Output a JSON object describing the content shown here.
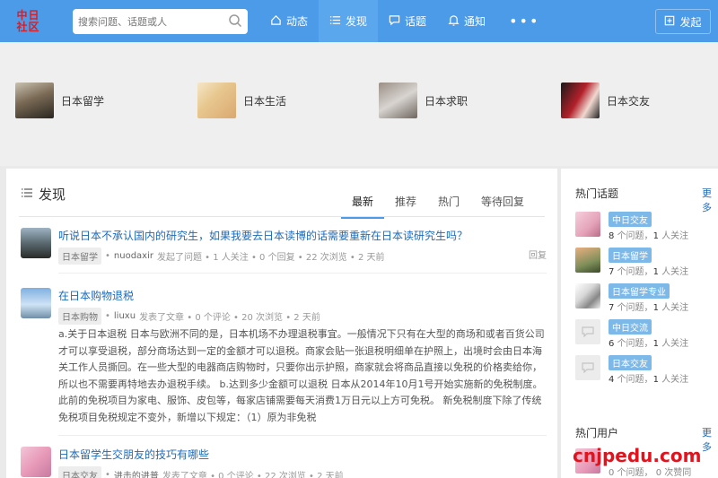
{
  "header": {
    "logo_line1": "中日",
    "logo_line2": "社区",
    "search_placeholder": "搜索问题、话题或人",
    "nav": [
      {
        "label": "动态",
        "icon": "home-icon"
      },
      {
        "label": "发现",
        "icon": "list-icon"
      },
      {
        "label": "话题",
        "icon": "chat-icon"
      },
      {
        "label": "通知",
        "icon": "bell-icon"
      }
    ],
    "more_label": "•••",
    "publish_label": "发起"
  },
  "categories": [
    {
      "label": "日本留学"
    },
    {
      "label": "日本生活"
    },
    {
      "label": "日本求职"
    },
    {
      "label": "日本交友"
    }
  ],
  "main": {
    "section_title": "发现",
    "tabs": [
      "最新",
      "推荐",
      "热门",
      "等待回复"
    ],
    "items": [
      {
        "title": "听说日本不承认国内的研究生，如果我要去日本读博的话需要重新在日本读研究生吗？",
        "tag": "日本留学",
        "author": "nuodaxir",
        "meta": "发起了问题 • 1 人关注 • 0 个回复 • 22 次浏览 • 2 天前",
        "reply": "回复"
      },
      {
        "title": "在日本购物退税",
        "tag": "日本购物",
        "author": "liuxu",
        "meta": "发表了文章 • 0 个评论 • 20 次浏览 • 2 天前",
        "excerpt": "a.关于日本退税 日本与欧洲不同的是，日本机场不办理退税事宜。一般情况下只有在大型的商场和或者百货公司才可以享受退税，部分商场达到一定的金额才可以退税。商家会贴一张退税明细单在护照上，出境时会由日本海关工作人员撕回。在一些大型的电器商店购物时，只要你出示护照，商家就会将商品直接以免税的价格卖给你，所以也不需要再特地去办退税手续。 b.达到多少金额可以退税 日本从2014年10月1号开始实施新的免税制度。此前的免税项目为家电、服饰、皮包等，每家店铺需要每天消费1万日元以上方可免税。 新免税制度下除了传统免税项目免税规定不变外，新增以下规定：（1）原为非免税"
      },
      {
        "title": "日本留学生交朋友的技巧有哪些",
        "tag": "日本交友",
        "author": "进击的进普",
        "meta": "发表了文章 • 0 个评论 • 22 次浏览 • 2 天前"
      }
    ]
  },
  "sidebar": {
    "hot_topics_title": "热门话题",
    "more_label": "更多",
    "topics": [
      {
        "name": "中日交友",
        "questions": "8",
        "followers": "1",
        "q_label": "个问题，",
        "f_label": "人关注"
      },
      {
        "name": "日本留学",
        "questions": "7",
        "followers": "1",
        "q_label": "个问题，",
        "f_label": "人关注"
      },
      {
        "name": "日本留学专业",
        "questions": "7",
        "followers": "1",
        "q_label": "个问题，",
        "f_label": "人关注"
      },
      {
        "name": "中日交流",
        "questions": "6",
        "followers": "1",
        "q_label": "个问题，",
        "f_label": "人关注"
      },
      {
        "name": "日本交友",
        "questions": "4",
        "followers": "1",
        "q_label": "个问题，",
        "f_label": "人关注"
      }
    ],
    "hot_users_title": "热门用户",
    "hot_users_more": "更多",
    "user_stat1": "0 个问题，",
    "user_stat2": "0 次赞同"
  },
  "watermark": "cnjpedu.com",
  "colors": {
    "header_bg": "#4c9be8",
    "link": "#1e6bb8",
    "logo_red": "#d3202a",
    "tag_blue": "#7db9e8"
  }
}
